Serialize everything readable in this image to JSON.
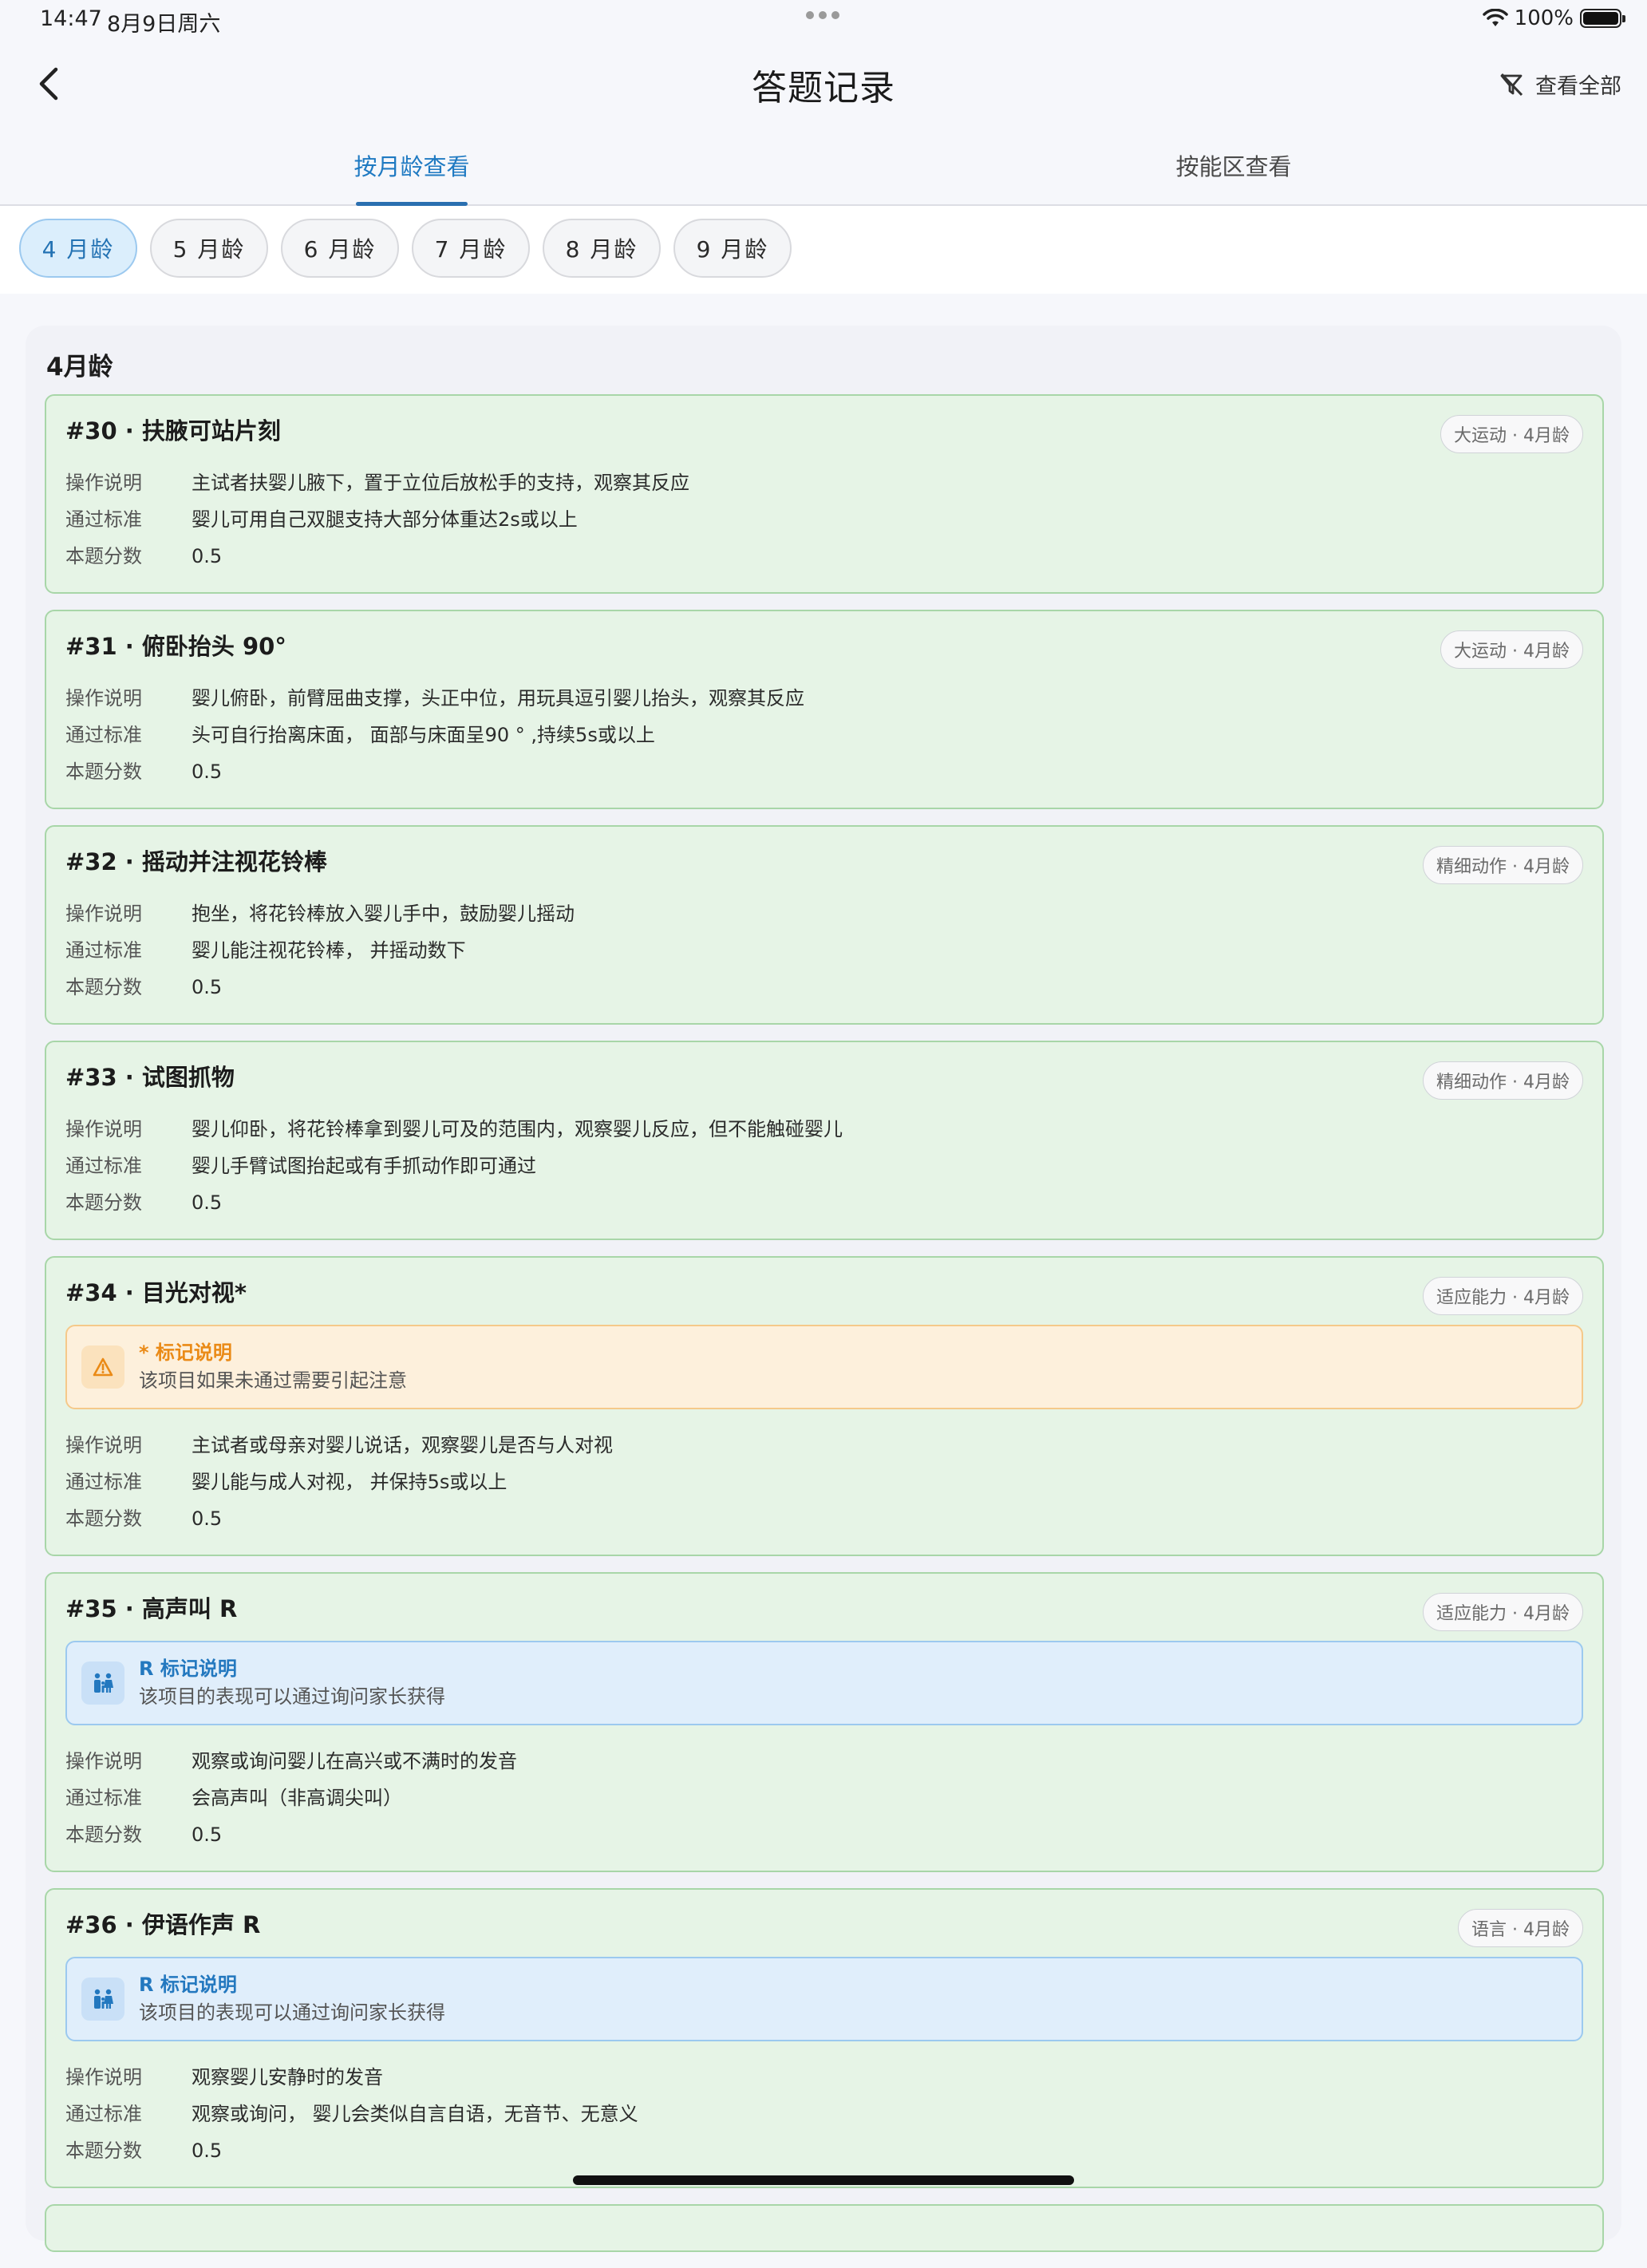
{
  "status_bar": {
    "time": "14:47",
    "date": "8月9日周六",
    "battery": "100%"
  },
  "nav": {
    "title": "答题记录",
    "view_all": "查看全部"
  },
  "tabs": [
    {
      "label": "按月龄查看"
    },
    {
      "label": "按能区查看"
    }
  ],
  "chips": [
    {
      "label": "4 月龄"
    },
    {
      "label": "5 月龄"
    },
    {
      "label": "6 月龄"
    },
    {
      "label": "7 月龄"
    },
    {
      "label": "8 月龄"
    },
    {
      "label": "9 月龄"
    }
  ],
  "group_title": "4月龄",
  "field_labels": {
    "operation": "操作说明",
    "standard": "通过标准",
    "score": "本题分数"
  },
  "notes": {
    "star": {
      "title": "* 标记说明",
      "desc": "该项目如果未通过需要引起注意"
    },
    "r": {
      "title": "R 标记说明",
      "desc": "该项目的表现可以通过询问家长获得"
    }
  },
  "items": [
    {
      "title": "#30 · 扶腋可站片刻",
      "tag": "大运动 · 4月龄",
      "operation": "主试者扶婴儿腋下，置于立位后放松手的支持，观察其反应",
      "standard": "婴儿可用自己双腿支持大部分体重达2s或以上",
      "score": "0.5"
    },
    {
      "title": "#31 · 俯卧抬头 90°",
      "tag": "大运动 · 4月龄",
      "operation": "婴儿俯卧，前臂屈曲支撑，头正中位，用玩具逗引婴儿抬头，观察其反应",
      "standard": "头可自行抬离床面， 面部与床面呈90 ° ,持续5s或以上",
      "score": "0.5"
    },
    {
      "title": "#32 · 摇动并注视花铃棒",
      "tag": "精细动作 · 4月龄",
      "operation": "抱坐，将花铃棒放入婴儿手中，鼓励婴儿摇动",
      "standard": "婴儿能注视花铃棒， 并摇动数下",
      "score": "0.5"
    },
    {
      "title": "#33 · 试图抓物",
      "tag": "精细动作 · 4月龄",
      "operation": "婴儿仰卧，将花铃棒拿到婴儿可及的范围内，观察婴儿反应，但不能触碰婴儿",
      "standard": "婴儿手臂试图抬起或有手抓动作即可通过",
      "score": "0.5"
    },
    {
      "title": "#34 · 目光对视*",
      "tag": "适应能力 · 4月龄",
      "operation": "主试者或母亲对婴儿说话，观察婴儿是否与人对视",
      "standard": "婴儿能与成人对视， 并保持5s或以上",
      "score": "0.5"
    },
    {
      "title": "#35 · 高声叫 R",
      "tag": "适应能力 · 4月龄",
      "operation": "观察或询问婴儿在高兴或不满时的发音",
      "standard": "会高声叫（非高调尖叫）",
      "score": "0.5"
    },
    {
      "title": "#36 · 伊语作声 R",
      "tag": "语言 · 4月龄",
      "operation": "观察婴儿安静时的发音",
      "standard": "观察或询问， 婴儿会类似自言自语，无音节、无意义",
      "score": "0.5"
    }
  ]
}
